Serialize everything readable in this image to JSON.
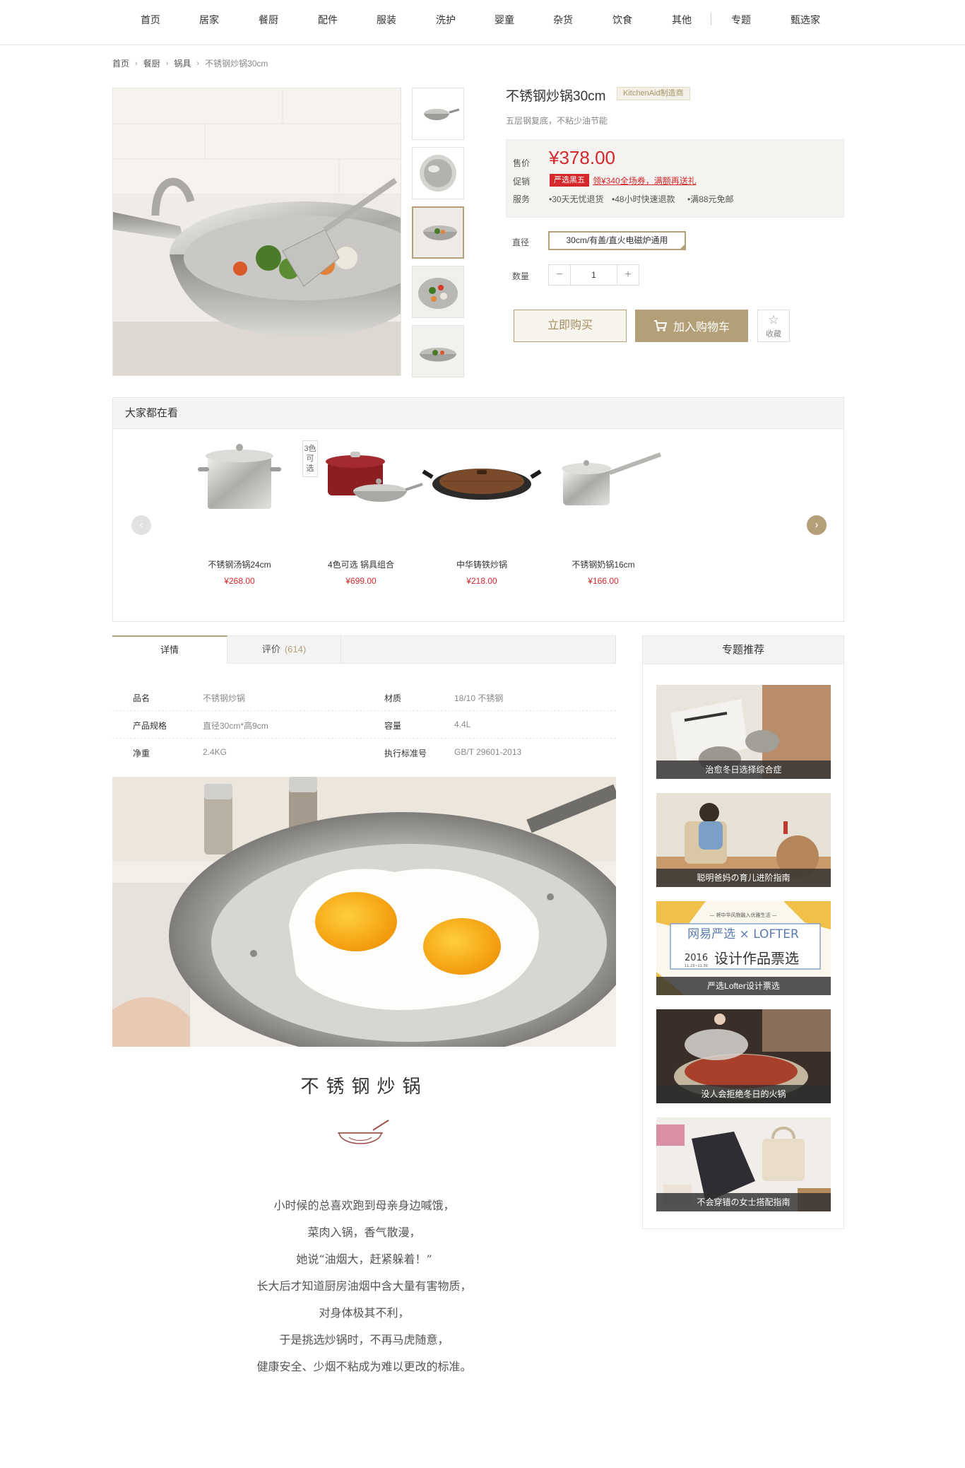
{
  "nav": {
    "items": [
      "首页",
      "居家",
      "餐厨",
      "配件",
      "服装",
      "洗护",
      "婴童",
      "杂货",
      "饮食",
      "其他",
      "专题",
      "甄选家"
    ]
  },
  "breadcrumb": [
    "首页",
    "餐厨",
    "锅具",
    "不锈钢炒锅30cm"
  ],
  "product": {
    "title": "不锈钢炒锅30cm",
    "brand_tag": "KitchenAid制造商",
    "subtitle": "五层钢复底，不粘少油节能",
    "price_label": "售价",
    "price": "¥378.00",
    "promo_label": "促销",
    "promo_badge": "严选黑五",
    "promo_text": "领¥340全场券，满额再送礼",
    "service_label": "服务",
    "services": [
      "•30天无忧退货",
      "•48小时快速退款",
      "•满88元免邮"
    ],
    "size_label": "直径",
    "size_option": "30cm/有盖/直火电磁炉通用",
    "qty_label": "数量",
    "qty_minus": "−",
    "qty_value": "1",
    "qty_plus": "+",
    "buy_now": "立即购买",
    "add_cart": "加入购物车",
    "fav": "收藏"
  },
  "watching": {
    "title": "大家都在看",
    "items": [
      {
        "name": "不锈钢汤锅24cm",
        "price": "¥268.00"
      },
      {
        "name": "4色可选  锅具组合",
        "price": "¥699.00",
        "tag": "3色可选"
      },
      {
        "name": "中华铸铁炒锅",
        "price": "¥218.00"
      },
      {
        "name": "不锈钢奶锅16cm",
        "price": "¥166.00"
      }
    ]
  },
  "tabs": {
    "detail": "详情",
    "review": "评价",
    "review_count": "(614)"
  },
  "attrs": [
    {
      "k1": "品名",
      "v1": "不锈钢炒锅",
      "k2": "材质",
      "v2": "18/10 不锈钢"
    },
    {
      "k1": "产品规格",
      "v1": "直径30cm*高9cm",
      "k2": "容量",
      "v2": "4.4L"
    },
    {
      "k1": "净重",
      "v1": "2.4KG",
      "k2": "执行标准号",
      "v2": "GB/T 29601-2013"
    }
  ],
  "detail": {
    "title": "不锈钢炒锅",
    "poem": [
      "小时候的总喜欢跑到母亲身边喊饿，",
      "菜肉入锅，香气散漫，",
      "她说“油烟大，赶紧躲着！”",
      "长大后才知道厨房油烟中含大量有害物质，",
      "对身体极其不利，",
      "于是挑选炒锅时，不再马虎随意，",
      "健康安全、少烟不粘成为难以更改的标准。"
    ]
  },
  "topics": {
    "title": "专题推荐",
    "items": [
      {
        "caption": "治愈冬日选择综合症"
      },
      {
        "caption": "聪明爸妈の育儿进阶指南"
      },
      {
        "caption": "严选Lofter设计票选",
        "banner_top": "— 将中华风物融入优雅生活 —",
        "banner_brand": "网易严选 × LOFTER",
        "banner_year": "2016",
        "banner_main": "设计作品票选",
        "banner_date": "11.23~11.30"
      },
      {
        "caption": "没人会拒绝冬日的火锅"
      },
      {
        "caption": "不会穿错の女士搭配指南"
      }
    ]
  },
  "colors": {
    "accent": "#b4a078",
    "price_red": "#d4282d"
  }
}
